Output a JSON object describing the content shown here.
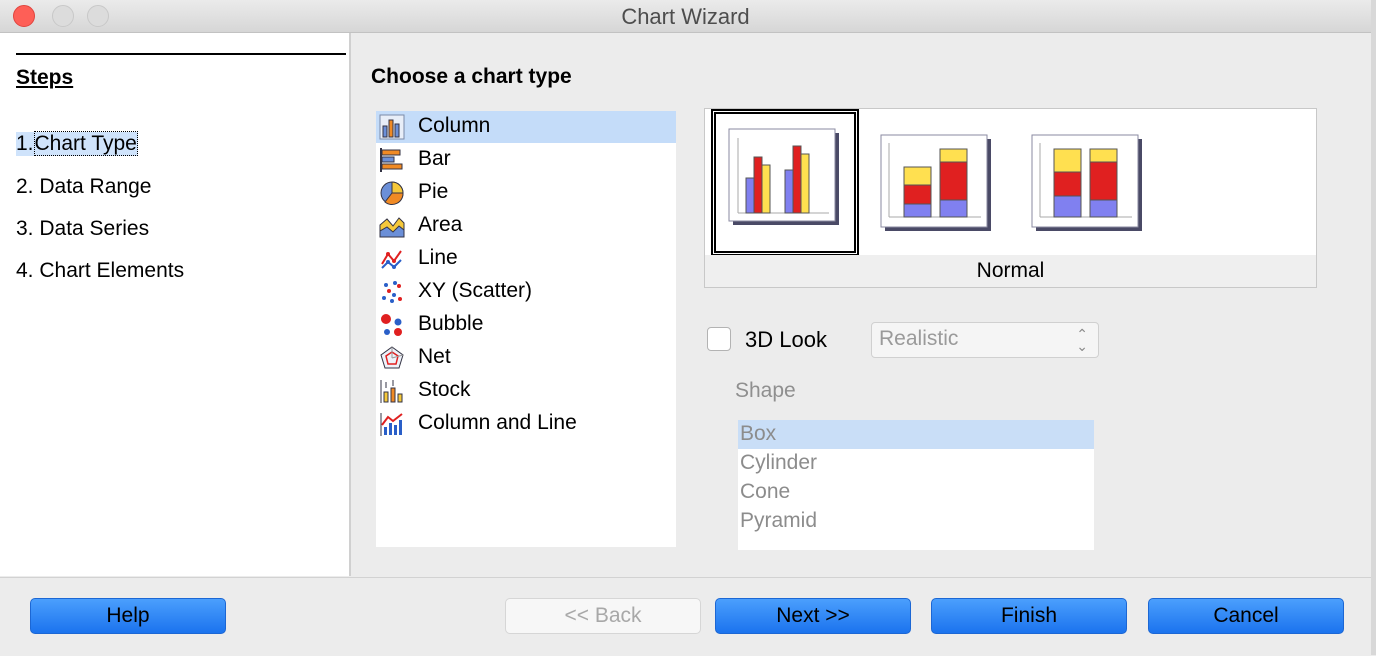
{
  "window": {
    "title": "Chart Wizard"
  },
  "steps": {
    "title": "Steps",
    "items": [
      {
        "num": "1.",
        "label": "Chart Type"
      },
      {
        "num": "2.",
        "label": "Data Range"
      },
      {
        "num": "3.",
        "label": "Data Series"
      },
      {
        "num": "4.",
        "label": "Chart Elements"
      }
    ]
  },
  "main": {
    "title": "Choose a chart type",
    "chart_types": [
      {
        "label": "Column",
        "icon": "column-chart-icon"
      },
      {
        "label": "Bar",
        "icon": "bar-chart-icon"
      },
      {
        "label": "Pie",
        "icon": "pie-chart-icon"
      },
      {
        "label": "Area",
        "icon": "area-chart-icon"
      },
      {
        "label": "Line",
        "icon": "line-chart-icon"
      },
      {
        "label": "XY (Scatter)",
        "icon": "scatter-chart-icon"
      },
      {
        "label": "Bubble",
        "icon": "bubble-chart-icon"
      },
      {
        "label": "Net",
        "icon": "net-chart-icon"
      },
      {
        "label": "Stock",
        "icon": "stock-chart-icon"
      },
      {
        "label": "Column and Line",
        "icon": "column-line-chart-icon"
      }
    ],
    "selected_type": "Column",
    "variant_caption": "Normal",
    "look3d": {
      "label": "3D Look",
      "checked": false,
      "select_value": "Realistic"
    },
    "shape": {
      "label": "Shape",
      "options": [
        "Box",
        "Cylinder",
        "Cone",
        "Pyramid"
      ],
      "selected": "Box"
    }
  },
  "buttons": {
    "help": "Help",
    "back": "<< Back",
    "next": "Next >>",
    "finish": "Finish",
    "cancel": "Cancel"
  },
  "colors": {
    "accent": "#1b73ee",
    "selection": "#c4dcf9",
    "bar_blue": "#8080f0",
    "bar_red": "#e02020",
    "bar_yellow": "#ffe050"
  }
}
